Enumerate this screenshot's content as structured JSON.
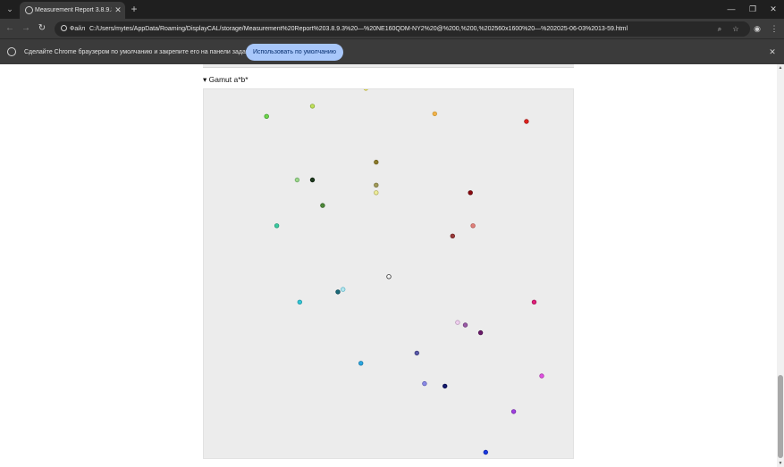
{
  "browser": {
    "tab_title": "Measurement Report 3.8.9.3 —",
    "tab_list_icon": "chevron-down-icon",
    "tab_close_glyph": "✕",
    "new_tab_glyph": "+",
    "window_controls": {
      "minimize": "—",
      "maximize": "❐",
      "close": "✕"
    },
    "nav": {
      "back": "←",
      "forward": "→",
      "reload": "↻"
    },
    "site_chip": "Файл",
    "url": "C:/Users/mytes/AppData/Roaming/DisplayCAL/storage/Measurement%20Report%203.8.9.3%20—%20NE160QDM-NY2%20@%200,%200,%202560x1600%20—%202025-06-03%2013-59.html",
    "zoom_glyph": "⌕",
    "bookmark_glyph": "☆",
    "profile_glyph": "◉",
    "menu_glyph": "⋮"
  },
  "infobar": {
    "text": "Сделайте Chrome браузером по умолчанию и закрепите его на панели задач.",
    "button_label": "Использовать по умолчанию",
    "close_glyph": "✕"
  },
  "report": {
    "section_summary": "▾ Gamut a*b*"
  },
  "scrollbar": {
    "up_glyph": "▲",
    "down_glyph": "▼",
    "position_fraction": 0.9
  },
  "gamut_points": [
    {
      "color": "#6fd64a",
      "outline": "#3c9a2a",
      "a": -48,
      "b": 62
    },
    {
      "color": "#bfe05a",
      "outline": "#8aa83a",
      "a": -30,
      "b": 66
    },
    {
      "color": "#e2e46a",
      "outline": "#b8ab35",
      "a": -9,
      "b": 73
    },
    {
      "color": "#f2b04a",
      "outline": "#c89a3a",
      "a": 18,
      "b": 63
    },
    {
      "color": "#e0221c",
      "outline": "#a01818",
      "a": 54,
      "b": 60
    },
    {
      "color": "#8a7a2a",
      "outline": "#6e5f1e",
      "a": -5,
      "b": 44
    },
    {
      "color": "#9ed68a",
      "outline": "#6ea86a",
      "a": -36,
      "b": 37
    },
    {
      "color": "#1e3a1e",
      "outline": "#0f220f",
      "a": -30,
      "b": 37
    },
    {
      "color": "#a09a58",
      "outline": "#7a7440",
      "a": -5,
      "b": 35
    },
    {
      "color": "#ecec9a",
      "outline": "#b5b060",
      "a": -5,
      "b": 32
    },
    {
      "color": "#8a0a10",
      "outline": "#5e0408",
      "a": 32,
      "b": 32
    },
    {
      "color": "#4e8a3a",
      "outline": "#2f5e22",
      "a": -26,
      "b": 27
    },
    {
      "color": "#3acaa0",
      "outline": "#2a9a78",
      "a": -44,
      "b": 19
    },
    {
      "color": "#e0807a",
      "outline": "#b05a56",
      "a": 33,
      "b": 19
    },
    {
      "color": "#9a3a3a",
      "outline": "#6e2424",
      "a": 25,
      "b": 15
    },
    {
      "color": "#f7f7f7",
      "outline": "#333333",
      "a": 0,
      "b": -1
    },
    {
      "color": "#1a6a7a",
      "outline": "#0e4a56",
      "a": -20,
      "b": -7
    },
    {
      "color": "#b6e6ee",
      "outline": "#62b8c8",
      "a": -18,
      "b": -6
    },
    {
      "color": "#33c6d6",
      "outline": "#1f96a4",
      "a": -35,
      "b": -11
    },
    {
      "color": "#e0207a",
      "outline": "#a81458",
      "a": 57,
      "b": -11
    },
    {
      "color": "#f0d0f0",
      "outline": "#b89ab8",
      "a": 27,
      "b": -19
    },
    {
      "color": "#9a5aa6",
      "outline": "#6e3e7a",
      "a": 30,
      "b": -20
    },
    {
      "color": "#6a1a6a",
      "outline": "#4a0e4a",
      "a": 36,
      "b": -23
    },
    {
      "color": "#5a5aa8",
      "outline": "#3a3a7a",
      "a": 11,
      "b": -31
    },
    {
      "color": "#2aa6e0",
      "outline": "#1a7aa8",
      "a": -11,
      "b": -35
    },
    {
      "color": "#e050e0",
      "outline": "#a838a8",
      "a": 60,
      "b": -40
    },
    {
      "color": "#8a8ae6",
      "outline": "#5c5cb0",
      "a": 14,
      "b": -43
    },
    {
      "color": "#141a6e",
      "outline": "#0a0e4a",
      "a": 22,
      "b": -44
    },
    {
      "color": "#a040e0",
      "outline": "#7428a8",
      "a": 49,
      "b": -54
    },
    {
      "color": "#1a3ae0",
      "outline": "#1024a8",
      "a": 38,
      "b": -70
    }
  ]
}
